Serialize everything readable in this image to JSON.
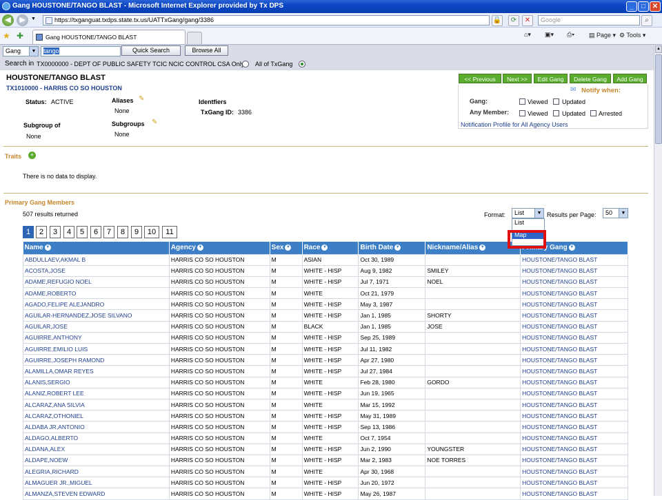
{
  "window": {
    "title": "Gang HOUSTONE/TANGO BLAST - Microsoft Internet Explorer provided by Tx DPS"
  },
  "browser": {
    "url": "https://txganguat.txdps.state.tx.us/UATTxGang/gang/3386",
    "search_placeholder": "Google",
    "tab_label": "Gang HOUSTONE/TANGO BLAST",
    "page_menu": "Page",
    "tools_menu": "Tools"
  },
  "searchbar": {
    "type_value": "Gang",
    "query": "tango",
    "quick_search": "Quick Search",
    "browse_all": "Browse All",
    "search_in_label": "Search in",
    "agency_text": "TX0000000 - DEPT OF PUBLIC SAFETY TCIC NCIC CONTROL CSA Only",
    "all_option": "All of TxGang"
  },
  "gang": {
    "name": "HOUSTONE/TANGO BLAST",
    "agency": "TX1010000 - HARRIS CO SO HOUSTON",
    "status_label": "Status:",
    "status": "ACTIVE",
    "aliases_label": "Aliases",
    "aliases": "None",
    "identifiers_label": "Identfiers",
    "txgang_id_label": "TxGang ID:",
    "txgang_id": "3386",
    "subgroup_of_label": "Subgroup of",
    "subgroup_of": "None",
    "subgroups_label": "Subgroups",
    "subgroups": "None"
  },
  "actions": {
    "previous": "<< Previous",
    "next": "Next >>",
    "edit": "Edit Gang",
    "delete": "Delete Gang",
    "add": "Add Gang"
  },
  "notify": {
    "title": "Notify when:",
    "gang_label": "Gang:",
    "any_member_label": "Any Member:",
    "viewed": "Viewed",
    "updated": "Updated",
    "arrested": "Arrested",
    "profile_link": "Notification Profile for All Agency Users"
  },
  "traits": {
    "title": "Traits",
    "empty": "There is no data to display."
  },
  "members": {
    "title": "Primary Gang Members",
    "results": "507 results returned",
    "format_label": "Format:",
    "format_value": "List",
    "results_per_page_label": "Results per Page:",
    "results_per_page": "50",
    "format_options": [
      "List",
      "Map"
    ],
    "pages": [
      "1",
      "2",
      "3",
      "4",
      "5",
      "6",
      "7",
      "8",
      "9",
      "10",
      "11"
    ],
    "columns": [
      "Name",
      "Agency",
      "Sex",
      "Race",
      "Birth Date",
      "Nickname/Alias",
      "Primary Gang"
    ],
    "rows": [
      [
        "ABDULLAEV,AKMAL B",
        "HARRIS CO SO HOUSTON",
        "M",
        "ASIAN",
        "Oct 30, 1989",
        "",
        "HOUSTONE/TANGO BLAST"
      ],
      [
        "ACOSTA,JOSE",
        "HARRIS CO SO HOUSTON",
        "M",
        "WHITE - HISP",
        "Aug 9, 1982",
        "SMILEY",
        "HOUSTONE/TANGO BLAST"
      ],
      [
        "ADAME,REFUGIO NOEL",
        "HARRIS CO SO HOUSTON",
        "M",
        "WHITE - HISP",
        "Jul 7, 1971",
        "NOEL",
        "HOUSTONE/TANGO BLAST"
      ],
      [
        "ADAME,ROBERTO",
        "HARRIS CO SO HOUSTON",
        "M",
        "WHITE",
        "Oct 21, 1979",
        "",
        "HOUSTONE/TANGO BLAST"
      ],
      [
        "AGADO,FELIPE ALEJANDRO",
        "HARRIS CO SO HOUSTON",
        "M",
        "WHITE - HISP",
        "May 3, 1987",
        "",
        "HOUSTONE/TANGO BLAST"
      ],
      [
        "AGUILAR-HERNANDEZ,JOSE SILVANO",
        "HARRIS CO SO HOUSTON",
        "M",
        "WHITE - HISP",
        "Jan 1, 1985",
        "SHORTY",
        "HOUSTONE/TANGO BLAST"
      ],
      [
        "AGUILAR,JOSE",
        "HARRIS CO SO HOUSTON",
        "M",
        "BLACK",
        "Jan 1, 1985",
        "JOSE",
        "HOUSTONE/TANGO BLAST"
      ],
      [
        "AGUIRRE,ANTHONY",
        "HARRIS CO SO HOUSTON",
        "M",
        "WHITE - HISP",
        "Sep 25, 1989",
        "",
        "HOUSTONE/TANGO BLAST"
      ],
      [
        "AGUIRRE,EMILIO LUIS",
        "HARRIS CO SO HOUSTON",
        "M",
        "WHITE - HISP",
        "Jul 11, 1982",
        "",
        "HOUSTONE/TANGO BLAST"
      ],
      [
        "AGUIRRE,JOSEPH RAMOND",
        "HARRIS CO SO HOUSTON",
        "M",
        "WHITE - HISP",
        "Apr 27, 1980",
        "",
        "HOUSTONE/TANGO BLAST"
      ],
      [
        "ALAMILLA,OMAR REYES",
        "HARRIS CO SO HOUSTON",
        "M",
        "WHITE - HISP",
        "Jul 27, 1984",
        "",
        "HOUSTONE/TANGO BLAST"
      ],
      [
        "ALANIS,SERGIO",
        "HARRIS CO SO HOUSTON",
        "M",
        "WHITE",
        "Feb 28, 1980",
        "GORDO",
        "HOUSTONE/TANGO BLAST"
      ],
      [
        "ALANIZ,ROBERT LEE",
        "HARRIS CO SO HOUSTON",
        "M",
        "WHITE - HISP",
        "Jun 19, 1965",
        "",
        "HOUSTONE/TANGO BLAST"
      ],
      [
        "ALCARAZ,ANA SILVIA",
        "HARRIS CO SO HOUSTON",
        "M",
        "WHITE",
        "Mar 15, 1992",
        "",
        "HOUSTONE/TANGO BLAST"
      ],
      [
        "ALCARAZ,OTHONIEL",
        "HARRIS CO SO HOUSTON",
        "M",
        "WHITE - HISP",
        "May 31, 1989",
        "",
        "HOUSTONE/TANGO BLAST"
      ],
      [
        "ALDABA JR,ANTONIO",
        "HARRIS CO SO HOUSTON",
        "M",
        "WHITE - HISP",
        "Sep 13, 1986",
        "",
        "HOUSTONE/TANGO BLAST"
      ],
      [
        "ALDAGO,ALBERTO",
        "HARRIS CO SO HOUSTON",
        "M",
        "WHITE",
        "Oct 7, 1954",
        "",
        "HOUSTONE/TANGO BLAST"
      ],
      [
        "ALDANA,ALEX",
        "HARRIS CO SO HOUSTON",
        "M",
        "WHITE - HISP",
        "Jun 2, 1990",
        "YOUNGSTER",
        "HOUSTONE/TANGO BLAST"
      ],
      [
        "ALDAPE,NOEW",
        "HARRIS CO SO HOUSTON",
        "M",
        "WHITE - HISP",
        "Mar 2, 1983",
        "NOE TORRES",
        "HOUSTONE/TANGO BLAST"
      ],
      [
        "ALEGRIA,RICHARD",
        "HARRIS CO SO HOUSTON",
        "M",
        "WHITE",
        "Apr 30, 1968",
        "",
        "HOUSTONE/TANGO BLAST"
      ],
      [
        "ALMAGUER JR.,MIGUEL",
        "HARRIS CO SO HOUSTON",
        "M",
        "WHITE - HISP",
        "Jun 20, 1972",
        "",
        "HOUSTONE/TANGO BLAST"
      ],
      [
        "ALMANZA,STEVEN EDWARD",
        "HARRIS CO SO HOUSTON",
        "M",
        "WHITE - HISP",
        "May 26, 1987",
        "",
        "HOUSTONE/TANGO BLAST"
      ]
    ]
  }
}
